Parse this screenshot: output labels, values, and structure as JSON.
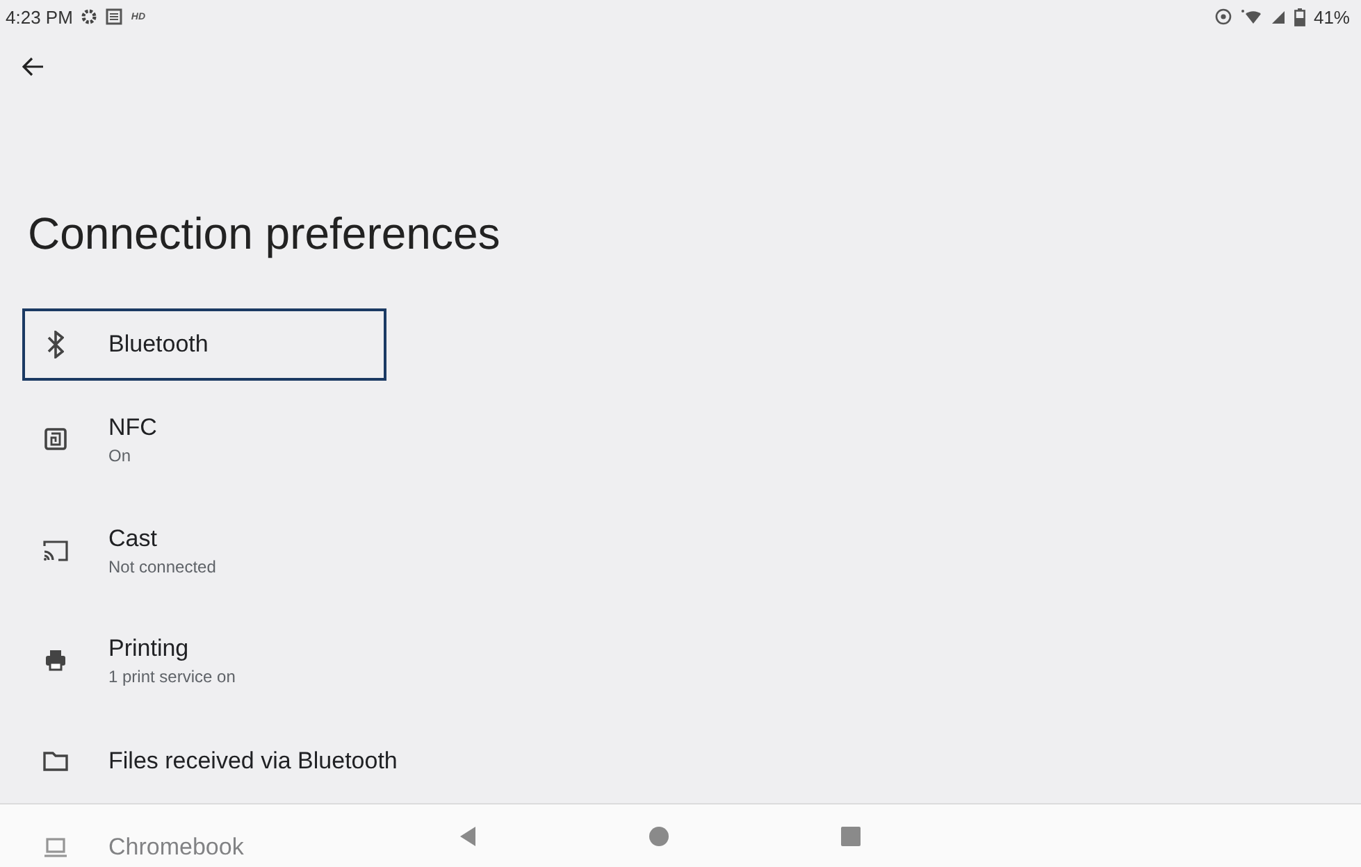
{
  "status_bar": {
    "time": "4:23 PM",
    "hd": "HD",
    "battery": "41%"
  },
  "title": "Connection preferences",
  "items": [
    {
      "kind": "bluetooth",
      "title": "Bluetooth",
      "focused": true
    },
    {
      "kind": "nfc",
      "title": "NFC",
      "subtitle": "On",
      "focused": false
    },
    {
      "kind": "cast",
      "title": "Cast",
      "subtitle": "Not connected",
      "focused": false
    },
    {
      "kind": "printer",
      "title": "Printing",
      "subtitle": "1 print service on",
      "focused": false
    },
    {
      "kind": "folder",
      "title": "Files received via Bluetooth",
      "focused": false
    },
    {
      "kind": "laptop",
      "title": "Chromebook",
      "focused": false
    }
  ]
}
